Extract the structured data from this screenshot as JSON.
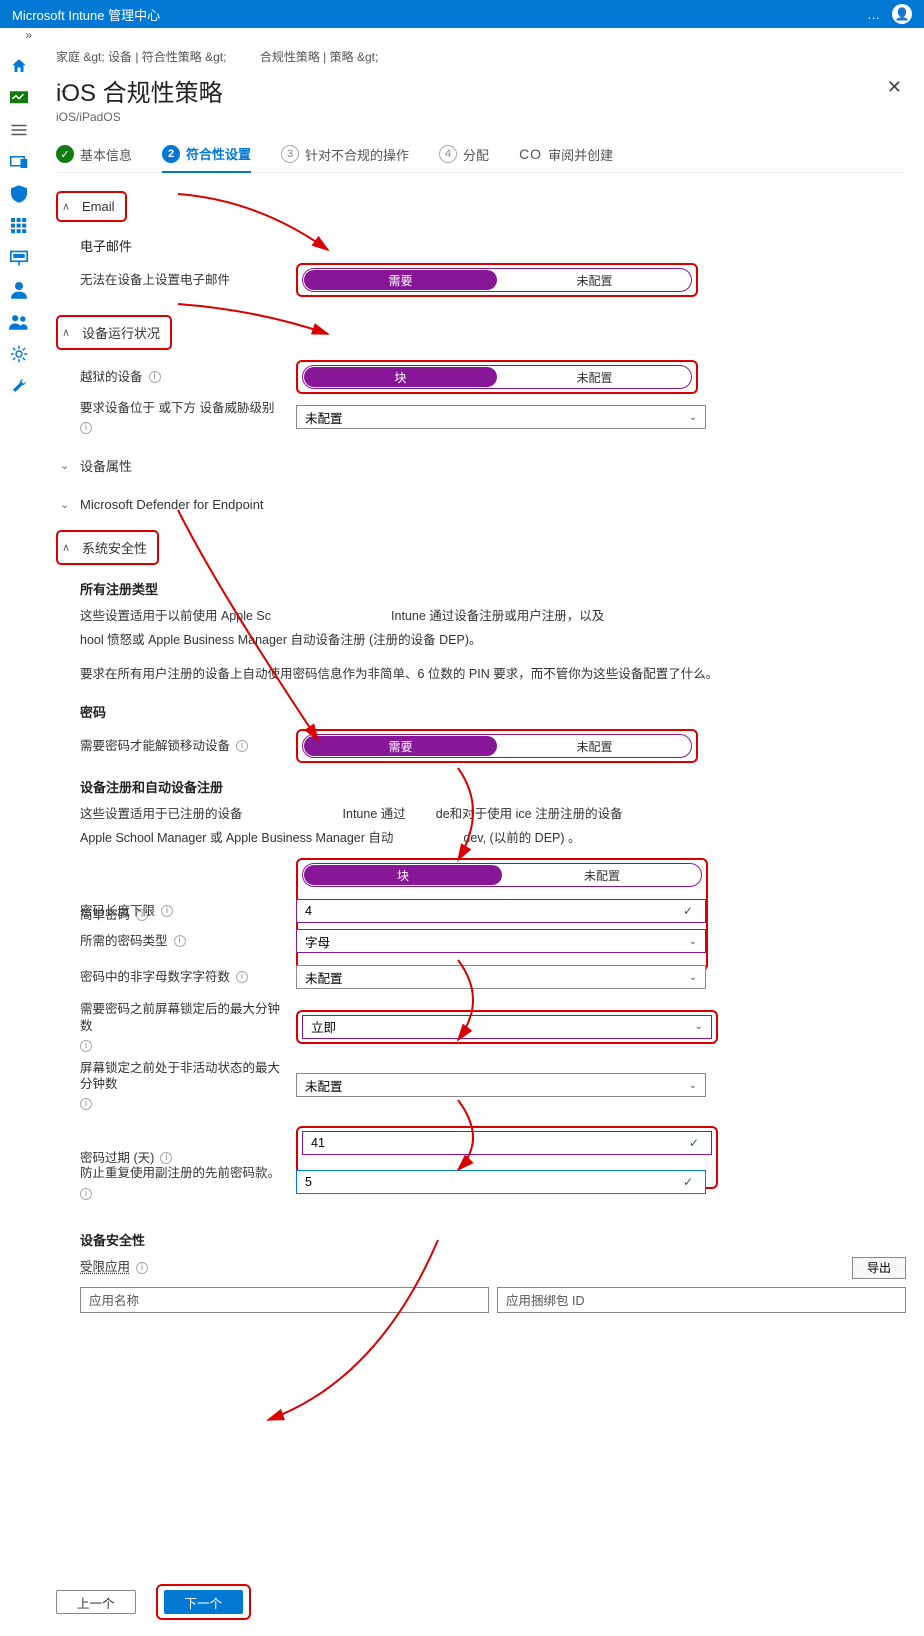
{
  "header": {
    "title": "Microsoft Intune 管理中心",
    "ellipsis": "…"
  },
  "breadcrumb": {
    "p1": "家庭 &gt;  设备 | 符合性策略 &gt;",
    "p2": "合规性策略 | 策略 &gt;",
    "p3": "…"
  },
  "page": {
    "title": "iOS 合规性策略",
    "subtitle": "iOS/iPadOS"
  },
  "wizard": {
    "s1": "基本信息",
    "s2": "符合性设置",
    "s3": "针对不合规的操作",
    "s4": "分配",
    "s5prefix": "CO",
    "s5": "审阅并创建"
  },
  "sections": {
    "email": {
      "header": "Email",
      "sub": "电子邮件",
      "row_label": "无法在设备上设置电子邮件"
    },
    "health": {
      "header": "设备运行状况",
      "jailbreak": "越狱的设备",
      "threat": "要求设备位于 或下方 设备威胁级别"
    },
    "props": {
      "header": "设备属性"
    },
    "defender": {
      "header": "Microsoft Defender for Endpoint"
    },
    "sec": {
      "header": "系统安全性",
      "allreg_title": "所有注册类型",
      "allreg_p1": "这些设置适用于以前使用 Apple Sc",
      "allreg_p1b": "Intune 通过设备注册或用户注册，以及",
      "allreg_p2": "hool 愤怒或 Apple Business Manager 自动设备注册 (注册的设备 DEP)。",
      "allreg_p3": "要求在所有用户注册的设备上自动使用密码信息作为非简单、6 位数的 PIN 要求，而不管你为这些设备配置了什么。",
      "pwd_title": "密码",
      "req_pwd": "需要密码才能解锁移动设备",
      "devreg_title": "设备注册和自动设备注册",
      "devreg_p1a": "这些设置适用于已注册的设备",
      "devreg_p1b": "Intune 通过",
      "devreg_p1c": "de和对于使用 ice 注册注册的设备",
      "devreg_p2": "Apple School Manager 或 Apple Business Manager 自动",
      "devreg_p2b": "dev,  (以前的 DEP) 。",
      "simple": "简单密码",
      "minlen": "密码长度下限",
      "pwtype": "所需的密码类型",
      "nonalpha": "密码中的非字母数字字符数",
      "maxmin_before_lock": "需要密码之前屏幕锁定后的最大分钟数",
      "maxmin_inactive": "屏幕锁定之前处于非活动状态的最大分钟数",
      "expire": "密码过期 (天)",
      "prevent_reuse": "防止重复使用副注册的先前密码款。",
      "devsec_title": "设备安全性",
      "restricted": "受限应用",
      "export": "导出",
      "appname_ph": "应用名称",
      "bundleid_ph": "应用捆绑包 ID"
    }
  },
  "values": {
    "require": "需要",
    "notconf": "未配置",
    "block": "块",
    "minlen": "4",
    "pwtype": "字母",
    "immediately": "立即",
    "expire": "41",
    "reuse": "5"
  },
  "footer": {
    "prev": "上一个",
    "next": "下一个"
  }
}
